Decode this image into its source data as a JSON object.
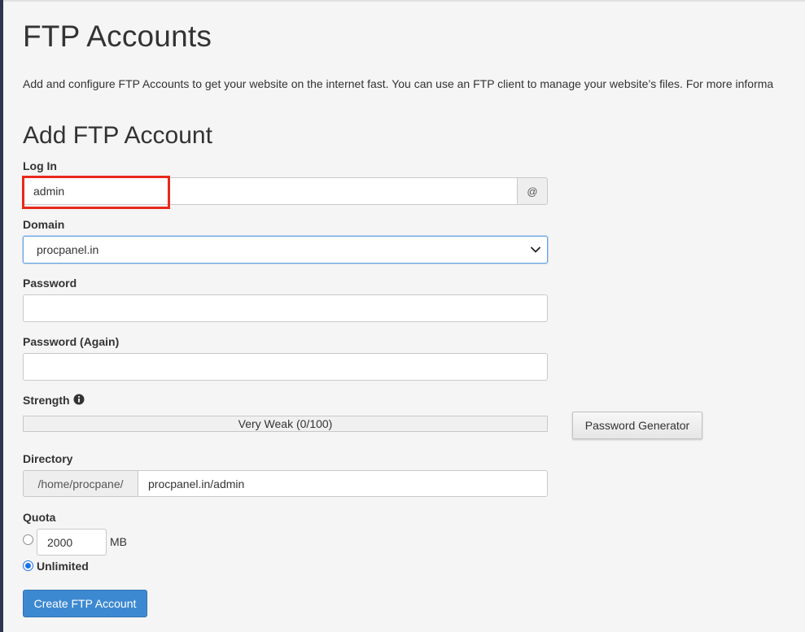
{
  "page": {
    "title": "FTP Accounts",
    "description": "Add and configure FTP Accounts to get your website on the internet fast. You can use an FTP client to manage your website’s files. For more informa"
  },
  "form": {
    "section_title": "Add FTP Account",
    "login": {
      "label": "Log In",
      "value": "admin",
      "addon": "@"
    },
    "domain": {
      "label": "Domain",
      "selected": "procpanel.in"
    },
    "password": {
      "label": "Password",
      "value": ""
    },
    "password_again": {
      "label": "Password (Again)",
      "value": ""
    },
    "strength": {
      "label": "Strength",
      "text": "Very Weak (0/100)",
      "score": 0,
      "max": 100,
      "info_icon": "info-circle-icon"
    },
    "password_generator_label": "Password Generator",
    "directory": {
      "label": "Directory",
      "prefix": "/home/procpane/",
      "value": "procpanel.in/admin"
    },
    "quota": {
      "label": "Quota",
      "limit_value": "2000",
      "unit": "MB",
      "unlimited_label": "Unlimited",
      "selected_option": "unlimited"
    },
    "submit_label": "Create FTP Account"
  },
  "colors": {
    "primary_button": "#3d89d1",
    "highlight": "#e8291c",
    "focus_border": "#66a3e0",
    "sidebar_rail": "#2b3650"
  }
}
